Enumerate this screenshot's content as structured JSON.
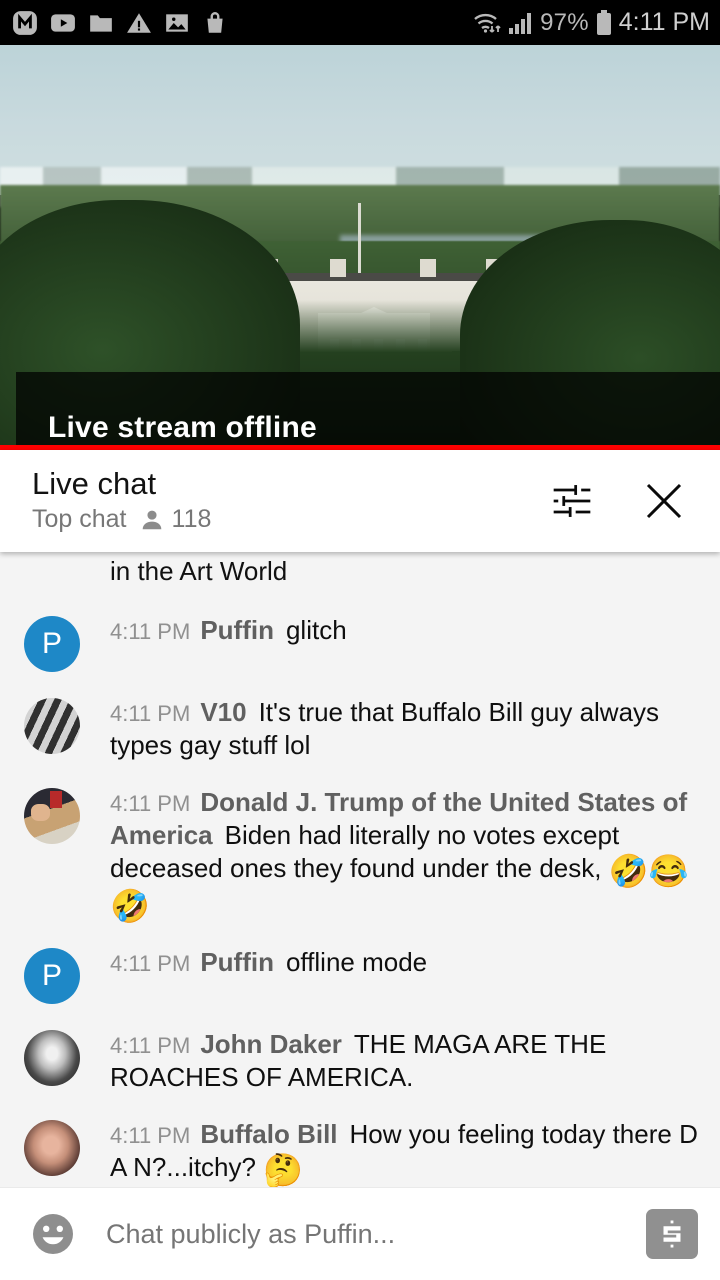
{
  "status_bar": {
    "left_icons": [
      {
        "name": "messenger-app-icon",
        "glyph": "M"
      },
      {
        "name": "youtube-icon",
        "glyph": "play"
      },
      {
        "name": "folder-icon",
        "glyph": "folder"
      },
      {
        "name": "warning-triangle-icon",
        "glyph": "warning"
      },
      {
        "name": "image-icon",
        "glyph": "image"
      },
      {
        "name": "shopping-bag-icon",
        "glyph": "bag"
      }
    ],
    "wifi_icon": "wifi-data-icon",
    "signal_icon": "cellular-signal-icon",
    "battery_percent": "97%",
    "battery_icon": "battery-icon",
    "time": "4:11 PM"
  },
  "player": {
    "offline_label": "Live stream offline",
    "progress_color": "#ff0000",
    "progress_percent": 100
  },
  "chat_header": {
    "title": "Live chat",
    "subtitle": "Top chat",
    "viewer_icon": "person-icon",
    "viewer_count": "118",
    "settings_icon": "chat-settings-sliders-icon",
    "close_icon": "close-icon"
  },
  "chat": {
    "clipped_message": "in the Art World",
    "messages": [
      {
        "avatar_type": "letter",
        "avatar_letter": "P",
        "avatar_color": "#1e88c7",
        "timestamp": "4:11 PM",
        "author": "Puffin",
        "text": "glitch",
        "emojis": ""
      },
      {
        "avatar_type": "image",
        "avatar_class": "av-v10",
        "timestamp": "4:11 PM",
        "author": "V10",
        "text": "It's true that Buffalo Bill guy always types gay stuff lol",
        "emojis": ""
      },
      {
        "avatar_type": "image",
        "avatar_class": "av-trump",
        "timestamp": "4:11 PM",
        "author": "Donald J. Trump of the United States of America",
        "text": "Biden had literally no votes except deceased ones they found under the desk,",
        "emojis": "🤣😂🤣"
      },
      {
        "avatar_type": "letter",
        "avatar_letter": "P",
        "avatar_color": "#1e88c7",
        "timestamp": "4:11 PM",
        "author": "Puffin",
        "text": "offline mode",
        "emojis": ""
      },
      {
        "avatar_type": "image",
        "avatar_class": "av-daker",
        "timestamp": "4:11 PM",
        "author": "John Daker",
        "text": "THE MAGA ARE THE ROACHES OF AMERICA.",
        "emojis": ""
      },
      {
        "avatar_type": "image",
        "avatar_class": "av-bill",
        "timestamp": "4:11 PM",
        "author": "Buffalo Bill",
        "text": "How you feeling today there D A N?...itchy?",
        "emojis": "🤔"
      }
    ]
  },
  "input_bar": {
    "emoji_icon": "emoji-smiley-icon",
    "placeholder": "Chat publicly as Puffin...",
    "superchat_icon": "super-chat-dollar-icon"
  }
}
